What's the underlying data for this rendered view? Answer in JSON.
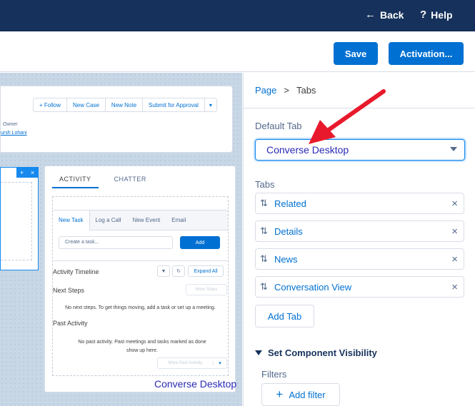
{
  "topbar": {
    "back_label": "Back",
    "help_label": "Help"
  },
  "toolbar": {
    "save_label": "Save",
    "activation_label": "Activation..."
  },
  "canvas": {
    "header_buttons": [
      "+ Follow",
      "New Case",
      "New Note",
      "Submit for Approval"
    ],
    "owner_label": "Owner",
    "owner_name": "ursh Lohani",
    "activity_tabs": [
      "ACTIVITY",
      "CHATTER"
    ],
    "publisher_tabs": [
      "New Task",
      "Log a Call",
      "New Event",
      "Email"
    ],
    "task_placeholder": "Create a task...",
    "add_label": "Add",
    "timeline_label": "Activity Timeline",
    "expand_all": "Expand All",
    "next_steps": "Next Steps",
    "more_steps": "More Steps",
    "no_next_steps": "No next steps. To get things moving, add a task or set up a meeting.",
    "past_activity": "Past Activity",
    "no_past_activity": "No past activity. Past meetings and tasks marked as done show up here.",
    "more_past": "More Past Activity",
    "caption": "Converse Desktop"
  },
  "props": {
    "crumb_page": "Page",
    "crumb_sep": ">",
    "crumb_current": "Tabs",
    "default_tab_label": "Default Tab",
    "default_tab_value": "Converse Desktop",
    "tabs_label": "Tabs",
    "tabs": [
      "Related",
      "Details",
      "News",
      "Conversation View"
    ],
    "add_tab": "Add Tab",
    "visibility_section": "Set Component Visibility",
    "filters_label": "Filters",
    "add_filter": "Add filter"
  },
  "colors": {
    "brand": "#0070d2",
    "header_bg": "#16325c",
    "annotation_arrow": "#e8192c",
    "caption": "#2a2ab8"
  }
}
